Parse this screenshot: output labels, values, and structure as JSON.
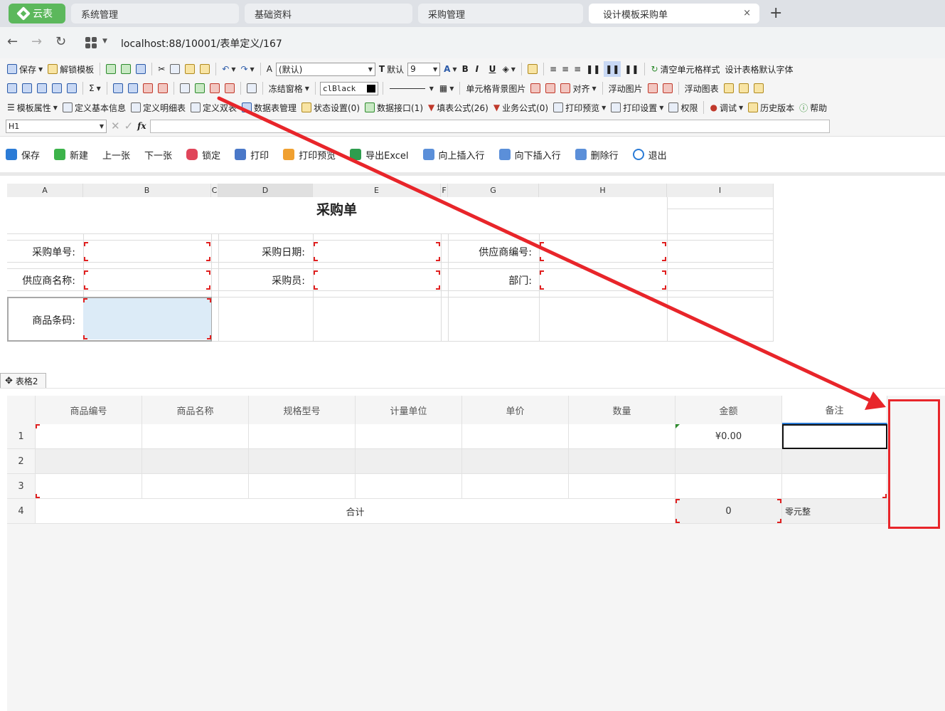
{
  "browser": {
    "logo_label": "云表",
    "tabs": [
      "系统管理",
      "基础资料",
      "采购管理",
      "设计模板采购单"
    ],
    "close_glyph": "×",
    "new_tab_glyph": "+",
    "address": "localhost:88/10001/表单定义/167"
  },
  "toolbar1": {
    "save": "保存",
    "unlock": "解锁模板",
    "font_name": "(默认)",
    "default_label": "默认",
    "font_size": "9",
    "bold": "B",
    "italic": "I",
    "underline": "U",
    "clear_style": "清空单元格样式",
    "default_font": "设计表格默认字体"
  },
  "toolbar2": {
    "freeze": "冻结窗格",
    "color": "clBlack",
    "cell_bg": "单元格背景图片",
    "align": "对齐",
    "float_image": "浮动图片",
    "float_chart": "浮动图表"
  },
  "toolbar3": {
    "template_props": "模板属性",
    "basic_info": "定义基本信息",
    "detail_table": "定义明细表",
    "define_table": "定义双表",
    "datatable_mgmt": "数据表管理",
    "status": "状态设置(0)",
    "data_api": "数据接口(1)",
    "fill_formula": "填表公式(26)",
    "biz_formula": "业务公式(0)",
    "print_preview": "打印预览",
    "print_settings": "打印设置",
    "permissions": "权限",
    "debug": "调试",
    "history": "历史版本",
    "help": "帮助"
  },
  "formula_bar": {
    "cell_ref": "H1",
    "fx": "fx"
  },
  "actions": [
    "保存",
    "新建",
    "上一张",
    "下一张",
    "锁定",
    "打印",
    "打印预览",
    "导出Excel",
    "向上插入行",
    "向下插入行",
    "删除行",
    "退出"
  ],
  "sheet": {
    "columns": [
      "A",
      "B",
      "C",
      "D",
      "E",
      "F",
      "G",
      "H",
      "I"
    ],
    "title": "采购单",
    "labels": {
      "order_no": "采购单号:",
      "order_date": "采购日期:",
      "supplier_no": "供应商编号:",
      "supplier_name": "供应商名称:",
      "buyer": "采购员:",
      "dept": "部门:",
      "barcode": "商品条码:"
    }
  },
  "table_tag": "表格2",
  "grid": {
    "headers": [
      "商品编号",
      "商品名称",
      "规格型号",
      "计量单位",
      "单价",
      "数量",
      "金额",
      "备注"
    ],
    "row_numbers": [
      "1",
      "2",
      "3",
      "4"
    ],
    "row1_amount": "¥0.00",
    "total_label": "合计",
    "total_value": "0",
    "total_text": "零元整"
  },
  "colors": {
    "accent_green": "#5cb85c",
    "annotation_red": "#e8252a",
    "selection_blue": "#dcebf7"
  }
}
